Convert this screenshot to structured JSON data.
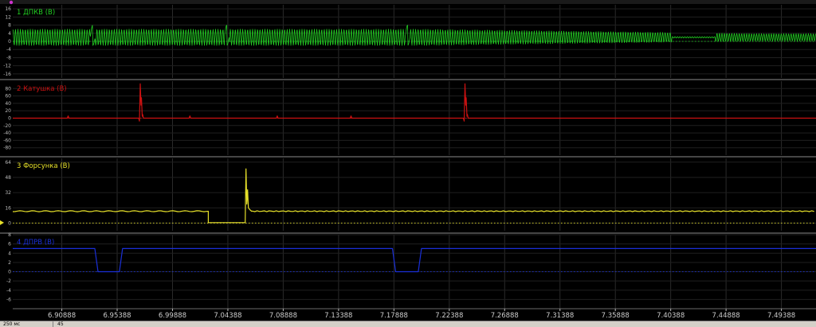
{
  "chart_data": {
    "type": "line",
    "x_ticks": [
      "6.90888",
      "6.95388",
      "6.99888",
      "7.04388",
      "7.08888",
      "7.13388",
      "7.17888",
      "7.22388",
      "7.26888",
      "7.31388",
      "7.35888",
      "7.40388",
      "7.44888",
      "7.49388"
    ],
    "xlim": [
      6.869,
      7.522
    ],
    "grid": true,
    "channels": [
      {
        "name": "1 ДПКВ (В)",
        "color": "#22cc22",
        "ylim": [
          -18,
          18
        ],
        "y_ticks": [
          "16",
          "12",
          "8",
          "4",
          "0",
          "-4",
          "-8",
          "-12",
          "-16"
        ],
        "kind": "crank",
        "level": 2,
        "amplitude": 4,
        "teeth_per_rev": 58,
        "gap_positions": [
          6.934,
          7.043,
          7.19
        ],
        "decay_start": 7.2,
        "decay_end": 7.47
      },
      {
        "name": "2 Катушка (В)",
        "color": "#cc1111",
        "ylim": [
          -100,
          100
        ],
        "y_ticks": [
          "80",
          "60",
          "40",
          "20",
          "0",
          "-20",
          "-40",
          "-60",
          "-80"
        ],
        "kind": "ignition",
        "baseline": 0,
        "spikes": [
          {
            "x": 6.972,
            "v": 93
          },
          {
            "x": 7.236,
            "v": 93
          }
        ],
        "small_pulses": [
          {
            "x": 6.914,
            "v": 6
          },
          {
            "x": 7.013,
            "v": 6
          },
          {
            "x": 7.084,
            "v": 6
          },
          {
            "x": 7.144,
            "v": 6
          }
        ]
      },
      {
        "name": "3 Форсунка (В)",
        "color": "#e6e02a",
        "ylim": [
          -8,
          68
        ],
        "y_ticks": [
          "64",
          "48",
          "32",
          "16",
          "0"
        ],
        "kind": "injector",
        "baseline": 12.5,
        "low": 0.5,
        "pulse_start": 7.028,
        "pulse_end": 7.058,
        "peak": 57
      },
      {
        "name": "4 ДПРВ (В)",
        "color": "#1a2fd8",
        "ylim": [
          -8,
          8
        ],
        "y_ticks": [
          "8",
          "6",
          "4",
          "2",
          "0",
          "-2",
          "-4",
          "-6"
        ],
        "kind": "cam",
        "high": 5,
        "low": 0,
        "lows": [
          [
            6.937,
            6.957
          ],
          [
            7.179,
            7.2
          ]
        ]
      }
    ]
  },
  "status": {
    "field1": "250 мс",
    "field2": "45"
  }
}
